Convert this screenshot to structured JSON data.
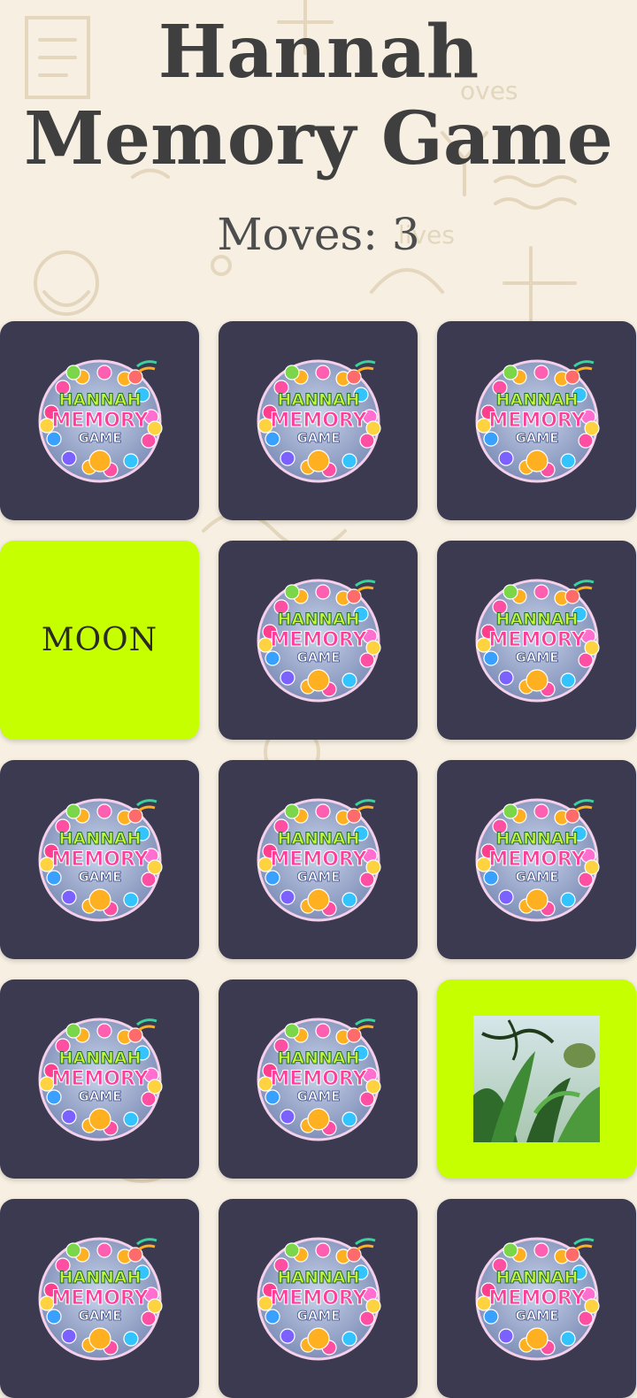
{
  "header": {
    "title_line1": "Hannah",
    "title_line2": "Memory Game",
    "moves_text": "Moves: 3"
  },
  "logo": {
    "line1": "HANNAH",
    "line2": "MEMORY",
    "line3": "GAME"
  },
  "cards": [
    {
      "state": "hidden"
    },
    {
      "state": "hidden"
    },
    {
      "state": "hidden"
    },
    {
      "state": "revealed",
      "type": "text",
      "text": "MOON"
    },
    {
      "state": "hidden"
    },
    {
      "state": "hidden"
    },
    {
      "state": "hidden"
    },
    {
      "state": "hidden"
    },
    {
      "state": "hidden"
    },
    {
      "state": "hidden"
    },
    {
      "state": "hidden"
    },
    {
      "state": "revealed",
      "type": "image",
      "image": "jungle-foliage"
    },
    {
      "state": "hidden"
    },
    {
      "state": "hidden"
    },
    {
      "state": "hidden"
    }
  ],
  "colors": {
    "card_back": "#3c3a50",
    "card_revealed": "#c6ff00",
    "title": "#3f3f3f",
    "background": "#f6efe2"
  }
}
